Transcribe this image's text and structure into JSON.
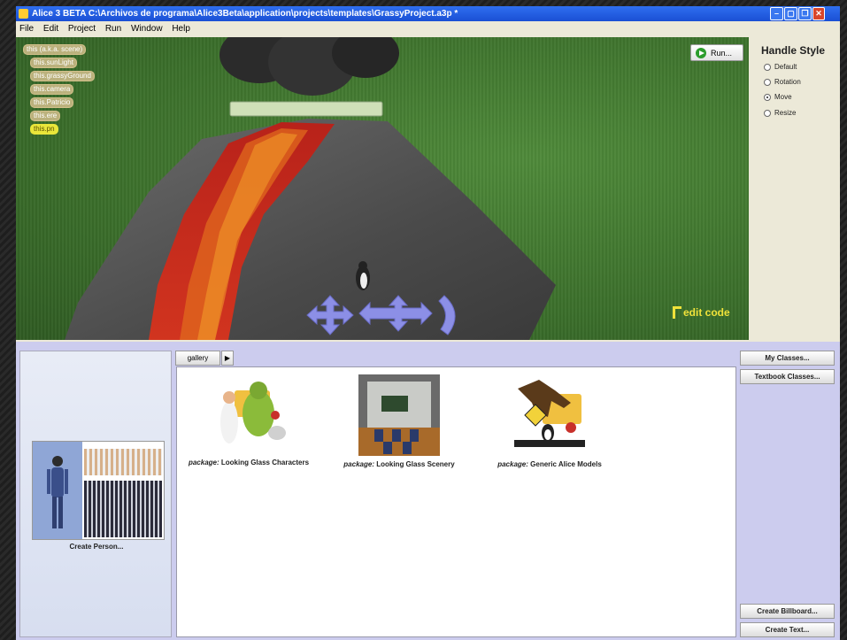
{
  "window": {
    "title": "Alice 3 BETA  C:\\Archivos de programa\\Alice3Beta\\application\\projects\\templates\\GrassyProject.a3p *",
    "controls": [
      "minimize",
      "maximize",
      "restore",
      "close"
    ]
  },
  "menu": {
    "items": [
      "File",
      "Edit",
      "Project",
      "Run",
      "Window",
      "Help"
    ]
  },
  "scene": {
    "tree": [
      "this (a.k.a. scene)",
      "this.sunLight",
      "this.grassyGround",
      "this.camera",
      "this.Patricio",
      "this.ere",
      "this.pn"
    ],
    "selected_index": 6,
    "run_label": "Run...",
    "edit_code_label": "edit code"
  },
  "handle_style": {
    "title": "Handle Style",
    "options": [
      "Default",
      "Rotation",
      "Move",
      "Resize"
    ],
    "selected": "Move"
  },
  "bottom": {
    "create_person_label": "Create Person...",
    "gallery_tab_label": "gallery",
    "gallery_arrow": "▶",
    "packages": [
      {
        "prefix": "package:",
        "name": "Looking Glass Characters"
      },
      {
        "prefix": "package:",
        "name": "Looking Glass Scenery"
      },
      {
        "prefix": "package:",
        "name": "Generic Alice Models"
      }
    ],
    "buttons": {
      "my_classes": "My Classes...",
      "textbook_classes": "Textbook Classes...",
      "create_billboard": "Create Billboard...",
      "create_text": "Create Text..."
    }
  },
  "colors": {
    "title_bar": "#1a4fd4",
    "grass": "#3b6f2b",
    "lava": "#c8281b",
    "selected_node": "#e9e63a",
    "edit_code": "#f0e23a",
    "handle_arrows": "#8c8fe6",
    "bottom_panel": "#ccccee"
  }
}
